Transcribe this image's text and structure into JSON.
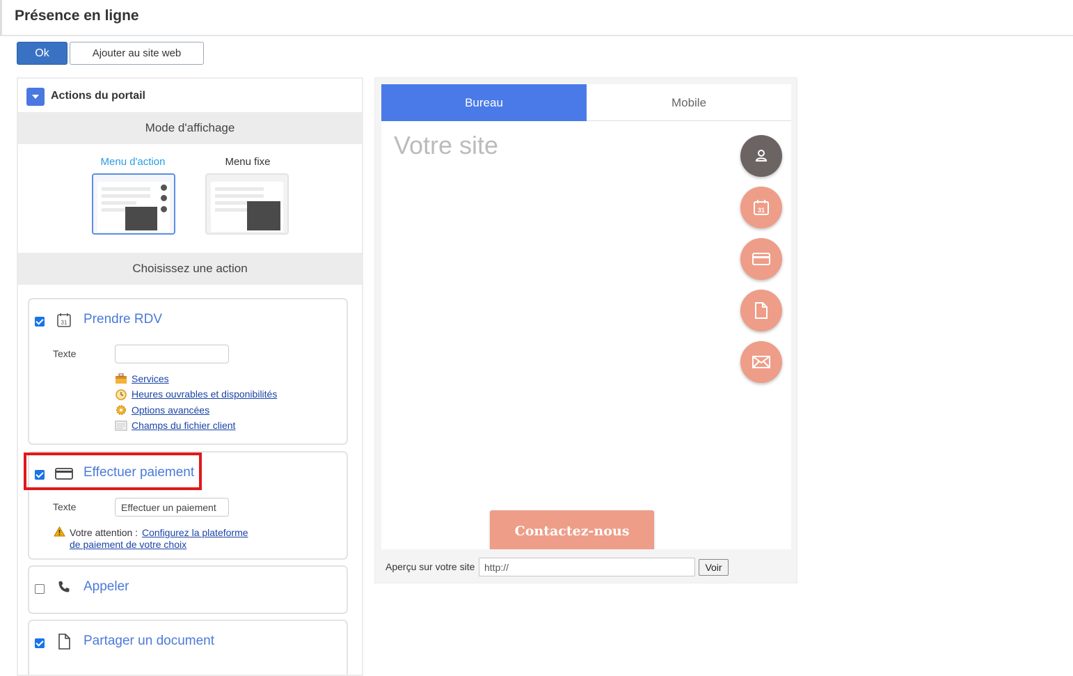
{
  "header": {
    "title": "Présence en ligne"
  },
  "toolbar": {
    "ok_label": "Ok",
    "add_site_label": "Ajouter au site web"
  },
  "portal": {
    "title": "Actions du portail",
    "display_mode_header": "Mode d'affichage",
    "modes": [
      {
        "label": "Menu d'action",
        "selected": true
      },
      {
        "label": "Menu fixe",
        "selected": false
      }
    ],
    "choose_action_header": "Choisissez une action",
    "actions": [
      {
        "title": "Prendre RDV",
        "checked": true,
        "icon": "calendar-icon",
        "text_label": "Texte",
        "text_value": "",
        "links": [
          "Services",
          "Heures ouvrables et disponibilités",
          "Options avancées",
          "Champs du fichier client"
        ]
      },
      {
        "title": "Effectuer paiement",
        "checked": true,
        "icon": "credit-card-icon",
        "text_label": "Texte",
        "text_value": "Effectuer un paiement",
        "warning_prefix": "Votre attention :",
        "warning_link_1": "Configurez la plateforme",
        "warning_link_2": "de paiement de votre choix"
      },
      {
        "title": "Appeler",
        "checked": false,
        "icon": "phone-icon"
      },
      {
        "title": "Partager un document",
        "checked": true,
        "icon": "document-icon"
      }
    ]
  },
  "preview": {
    "tabs": [
      "Bureau",
      "Mobile"
    ],
    "active_tab": "Bureau",
    "site_title": "Votre site",
    "fab_icons": [
      "user-icon",
      "calendar-icon",
      "credit-card-icon",
      "document-icon",
      "mail-icon"
    ],
    "contact_label": "Contactez-nous",
    "url_label": "Aperçu sur votre site",
    "url_placeholder": "http://",
    "voir_label": "Voir"
  },
  "colors": {
    "accent": "#4a7ae8",
    "fab": "#ee9d88",
    "fab_dark": "#6b6462",
    "highlight": "#e0181b"
  }
}
